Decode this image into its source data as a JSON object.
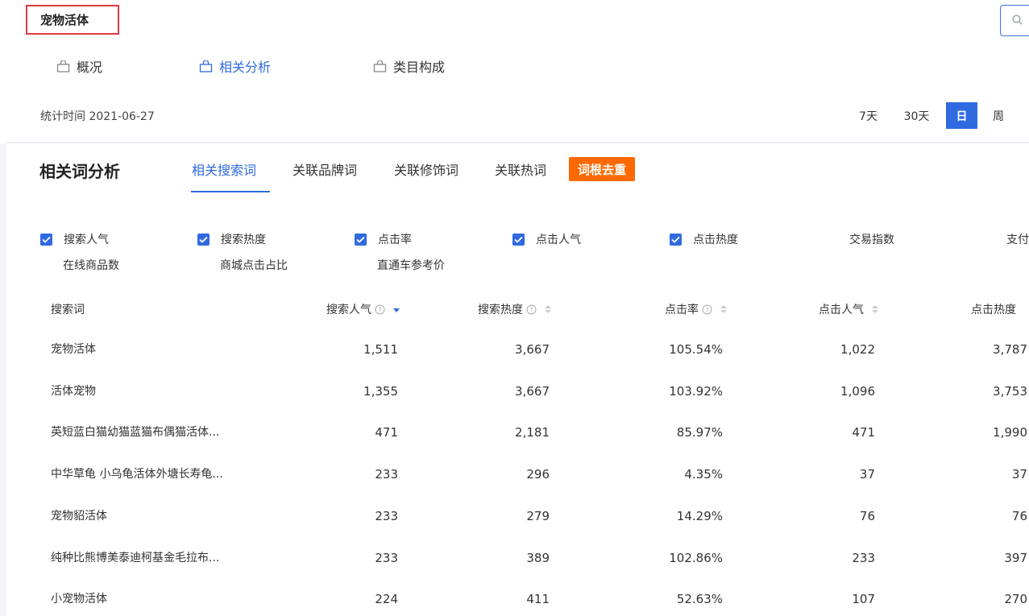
{
  "header": {
    "keyword": "宠物活体",
    "search_icon": "search-icon"
  },
  "nav_tabs": [
    {
      "label": "概况",
      "icon": "shopping-bag-icon",
      "active": false
    },
    {
      "label": "相关分析",
      "icon": "shopping-bag-icon",
      "active": true
    },
    {
      "label": "类目构成",
      "icon": "shopping-bag-icon",
      "active": false
    }
  ],
  "stat_time": {
    "label": "统计时间",
    "date": "2021-06-27"
  },
  "periods": [
    "7天",
    "30天",
    "日",
    "周"
  ],
  "active_period": "日",
  "section": {
    "title": "相关词分析",
    "tabs": [
      "相关搜索词",
      "关联品牌词",
      "关联修饰词",
      "关联热词"
    ],
    "active_tab": "相关搜索词",
    "dedupe_button": "词根去重"
  },
  "metrics": [
    {
      "label": "搜索人气",
      "checked": true
    },
    {
      "label": "搜索热度",
      "checked": true
    },
    {
      "label": "点击率",
      "checked": true
    },
    {
      "label": "点击人气",
      "checked": true
    },
    {
      "label": "点击热度",
      "checked": true
    },
    {
      "label": "交易指数",
      "checked": false
    },
    {
      "label": "支付",
      "checked": false
    },
    {
      "label": "在线商品数",
      "checked": false
    },
    {
      "label": "商城点击占比",
      "checked": false
    },
    {
      "label": "直通车参考价",
      "checked": false
    }
  ],
  "table": {
    "columns": [
      "搜索词",
      "搜索人气",
      "搜索热度",
      "点击率",
      "点击人气",
      "点击热度"
    ],
    "sorted_column": "搜索人气",
    "rows": [
      [
        "宠物活体",
        "1,511",
        "3,667",
        "105.54%",
        "1,022",
        "3,787"
      ],
      [
        "活体宠物",
        "1,355",
        "3,667",
        "103.92%",
        "1,096",
        "3,753"
      ],
      [
        "英短蓝白猫幼猫蓝猫布偶猫活体...",
        "471",
        "2,181",
        "85.97%",
        "471",
        "1,990"
      ],
      [
        "中华草龟 小乌龟活体外塘长寿龟...",
        "233",
        "296",
        "4.35%",
        "37",
        "37"
      ],
      [
        "宠物貂活体",
        "233",
        "279",
        "14.29%",
        "76",
        "76"
      ],
      [
        "纯种比熊博美泰迪柯基金毛拉布...",
        "233",
        "389",
        "102.86%",
        "233",
        "397"
      ],
      [
        "小宠物活体",
        "224",
        "411",
        "52.63%",
        "107",
        "270"
      ]
    ]
  },
  "colors": {
    "accent": "#2f6ae0",
    "orange": "#ff6a00",
    "highlight_border": "#e0393e"
  }
}
